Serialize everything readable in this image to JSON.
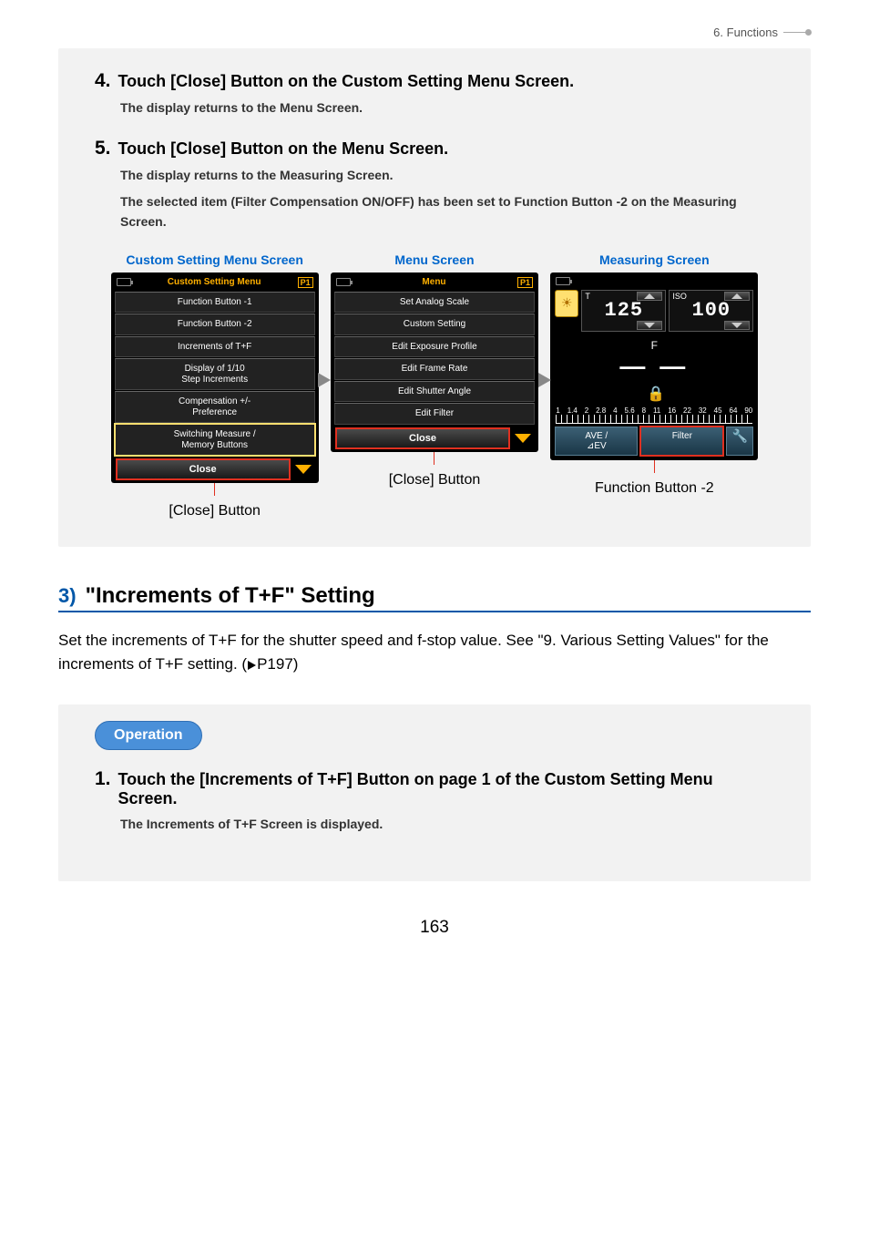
{
  "header": {
    "chapter": "6.  Functions"
  },
  "steps_a": [
    {
      "num": "4.",
      "title": "Touch [Close] Button on the Custom Setting Menu Screen.",
      "lines": [
        "The display returns to the Menu Screen."
      ]
    },
    {
      "num": "5.",
      "title": "Touch [Close] Button on the Menu Screen.",
      "lines": [
        "The display returns to the Measuring Screen.",
        "The selected item (Filter Compensation ON/OFF) has been set to Function Button -2 on the Measuring Screen."
      ]
    }
  ],
  "screens": {
    "custom": {
      "caption": "Custom Setting Menu Screen",
      "title": "Custom Setting Menu",
      "page_ind": "P1",
      "items": [
        "Function Button -1",
        "Function Button -2",
        "Increments of T+F",
        "Display of 1/10\nStep Increments",
        "Compensation +/-\nPreference",
        "Switching Measure /\nMemory Buttons"
      ],
      "close": "Close",
      "below": "[Close] Button"
    },
    "menu": {
      "caption": "Menu Screen",
      "title": "Menu",
      "page_ind": "P1",
      "items": [
        "Set Analog Scale",
        "Custom Setting",
        "Edit Exposure Profile",
        "Edit Frame Rate",
        "Edit Shutter Angle",
        "Edit Filter"
      ],
      "close": "Close",
      "below": "[Close] Button"
    },
    "meas": {
      "caption": "Measuring Screen",
      "t_label": "T",
      "iso_label": "ISO",
      "shutter": "125",
      "iso": "100",
      "f_label": "F",
      "f_value": "— —",
      "scale_nums": [
        "1",
        "1.4",
        "2",
        "2.8",
        "4",
        "5.6",
        "8",
        "11",
        "16",
        "22",
        "32",
        "45",
        "64",
        "90"
      ],
      "fn1": "AVE /\n⊿EV",
      "fn2": "Filter",
      "below": "Function Button -2"
    }
  },
  "section3": {
    "num": "3)",
    "title": "\"Increments of T+F\" Setting",
    "body_a": "Set the increments of T+F for the shutter speed and f-stop value. See \"9. Various Setting Values\" for the increments of T+F setting. (",
    "body_b": "P197)",
    "operation": "Operation",
    "step1_num": "1.",
    "step1_title": "Touch the [Increments of T+F] Button on page 1 of the Custom Setting Menu Screen.",
    "step1_line": "The Increments of T+F Screen is displayed."
  },
  "page_number": "163"
}
